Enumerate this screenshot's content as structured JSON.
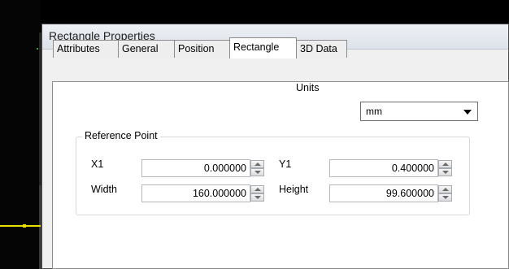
{
  "dialog": {
    "title": "Rectangle Properties"
  },
  "tabs": [
    {
      "label": "Attributes",
      "active": false
    },
    {
      "label": "General",
      "active": false
    },
    {
      "label": "Position",
      "active": false
    },
    {
      "label": "Rectangle",
      "active": true
    },
    {
      "label": "3D Data",
      "active": false
    }
  ],
  "units": {
    "label": "Units",
    "value": "mm"
  },
  "reference_point": {
    "title": "Reference Point",
    "x1_label": "X1",
    "x1_value": "0.000000",
    "y1_label": "Y1",
    "y1_value": "0.400000",
    "width_label": "Width",
    "width_value": "160.000000",
    "height_label": "Height",
    "height_value": "99.600000"
  },
  "colors": {
    "accent_line": "#e8e000",
    "dialog_bg": "#f0f0f0",
    "panel_bg": "#ffffff"
  }
}
